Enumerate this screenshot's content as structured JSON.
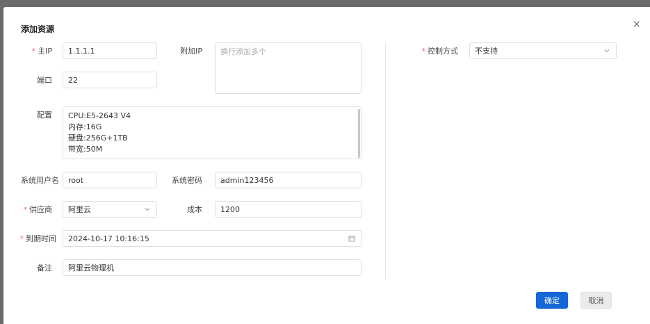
{
  "dialog": {
    "title": "添加资源",
    "close_label": "×"
  },
  "form": {
    "main_ip": {
      "label": "主IP",
      "value": "1.1.1.1"
    },
    "extra_ip": {
      "label": "附加IP",
      "placeholder": "换行添加多个"
    },
    "port": {
      "label": "端口",
      "value": "22"
    },
    "config": {
      "label": "配置",
      "lines": [
        "CPU:E5-2643 V4",
        "内存:16G",
        "硬盘:256G+1TB",
        "带宽:50M"
      ]
    },
    "sys_user": {
      "label": "系统用户名",
      "value": "root"
    },
    "sys_password": {
      "label": "系统密码",
      "value": "admin123456"
    },
    "supplier": {
      "label": "供应商",
      "value": "阿里云"
    },
    "cost": {
      "label": "成本",
      "value": "1200"
    },
    "expire_time": {
      "label": "到期时间",
      "value": "2024-10-17 10:16:15"
    },
    "remark": {
      "label": "备注",
      "value": "阿里云物理机"
    },
    "control_mode": {
      "label": "控制方式",
      "value": "不支持"
    }
  },
  "footer": {
    "confirm_label": "确定",
    "cancel_label": "取消"
  },
  "colors": {
    "primary": "#1666d8",
    "required": "#f56c6c",
    "overlay": "#6b6b6b"
  }
}
